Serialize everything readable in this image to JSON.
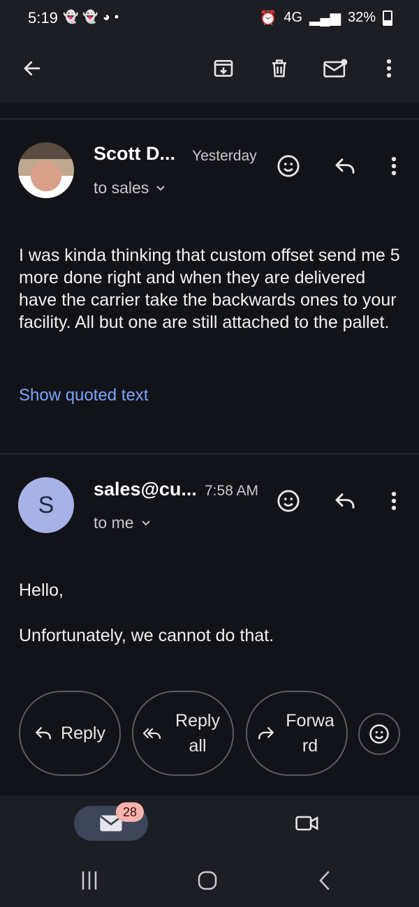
{
  "status_bar": {
    "time": "5:19",
    "network": "4G",
    "battery": "32%"
  },
  "messages": [
    {
      "sender": "Scott D...",
      "time": "Yesterday",
      "recipient": "to sales",
      "body": "I was kinda thinking that custom offset send me 5 more done right and when they are delivered have the carrier take the backwards ones to your facility. All but one are still attached to the pallet.",
      "show_quoted": "Show quoted text"
    },
    {
      "sender": "sales@cu...",
      "time": "7:58 AM",
      "recipient": "to me",
      "avatar_letter": "S",
      "body_line1": "Hello,",
      "body_line2": "Unfortunately, we cannot do that."
    }
  ],
  "actions": {
    "reply": "Reply",
    "reply_all": "Reply all",
    "forward": "Forwa rd"
  },
  "bottom_nav": {
    "mail_badge": "28"
  },
  "colors": {
    "background": "#121318",
    "link": "#7ba4ff",
    "badge": "#f7b3ad",
    "avatar_s": "#a7b3e6"
  }
}
